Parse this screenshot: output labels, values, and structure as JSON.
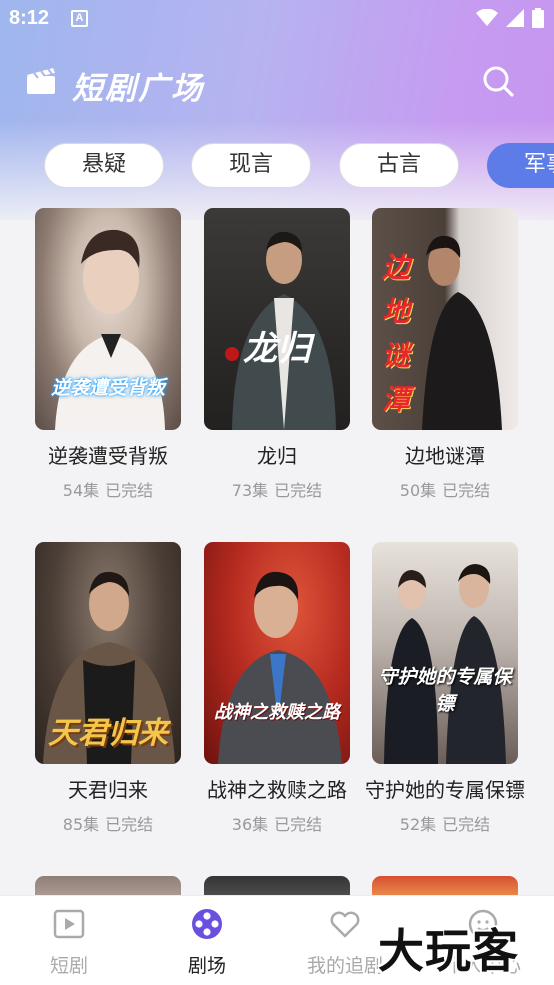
{
  "status_bar": {
    "time": "8:12",
    "notif_icon": "A"
  },
  "header": {
    "title": "短剧广场",
    "clapper_icon": "clapperboard-icon",
    "search_icon": "search-icon"
  },
  "categories": [
    "悬疑",
    "现言",
    "古言",
    "军事"
  ],
  "active_category_index": 3,
  "dramas": [
    {
      "title": "逆袭遭受背叛",
      "episodes": "54集",
      "status": "已完结",
      "poster_text": "逆袭遭受背叛"
    },
    {
      "title": "龙归",
      "episodes": "73集",
      "status": "已完结",
      "poster_text": "龙归"
    },
    {
      "title": "边地谜潭",
      "episodes": "50集",
      "status": "已完结",
      "poster_text": "边地谜潭"
    },
    {
      "title": "天君归来",
      "episodes": "85集",
      "status": "已完结",
      "poster_text": "天君归来"
    },
    {
      "title": "战神之救赎之路",
      "episodes": "36集",
      "status": "已完结",
      "poster_text": "战神之救赎之路"
    },
    {
      "title": "守护她的专属保镖",
      "episodes": "52集",
      "status": "已完结",
      "poster_text": "守护她的专属保镖"
    }
  ],
  "tabs": [
    {
      "label": "短剧",
      "icon": "play-icon"
    },
    {
      "label": "剧场",
      "icon": "theater-icon"
    },
    {
      "label": "我的追剧",
      "icon": "heart-icon"
    },
    {
      "label": "个人中心",
      "icon": "profile-icon"
    }
  ],
  "active_tab_index": 1,
  "watermark": "大玩客",
  "colors": {
    "accent": "#5e7ce8",
    "tab_active": "#6b4fe0",
    "meta_gray": "#999999"
  }
}
